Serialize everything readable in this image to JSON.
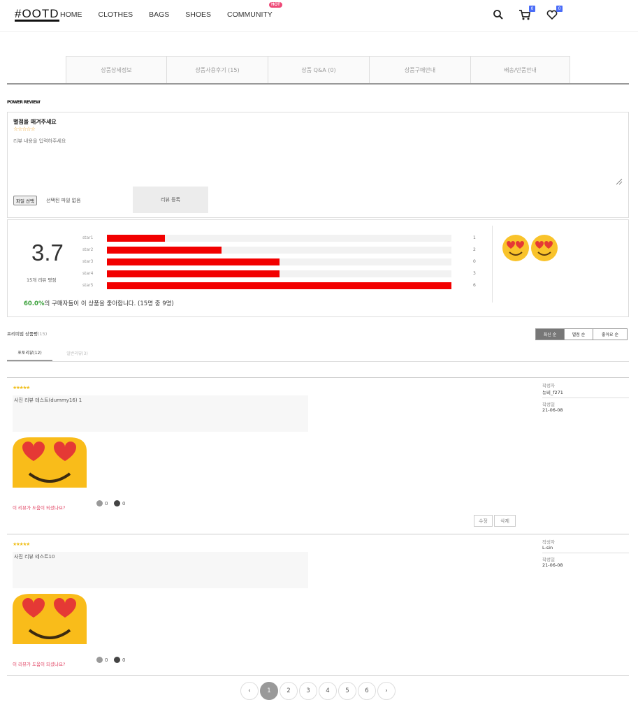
{
  "header": {
    "logo": "#OOTD",
    "nav": [
      {
        "label": "HOME"
      },
      {
        "label": "CLOTHES"
      },
      {
        "label": "BAGS"
      },
      {
        "label": "SHOES"
      },
      {
        "label": "COMMUNITY",
        "badge": "HOT"
      }
    ],
    "cart_count": "0",
    "wish_count": "0"
  },
  "tabs": [
    {
      "label": "상품상세정보"
    },
    {
      "label": "상품사용후기 (15)"
    },
    {
      "label": "상품 Q&A (0)"
    },
    {
      "label": "상품구매안내"
    },
    {
      "label": "배송/반품안내"
    }
  ],
  "power_review_title": "POWER REVIEW",
  "form": {
    "title": "별점을 매겨주세요",
    "stars": "☆☆☆☆☆",
    "placeholder": "리뷰 내용을 입력하주세요",
    "file_button": "파일 선택",
    "file_status": "선택된 파일 없음",
    "submit": "리뷰 등록"
  },
  "summary": {
    "average": "3.7",
    "count_text": "15개 리뷰 평점",
    "bars": [
      {
        "label": "star1",
        "count": "1",
        "fraction": 0.067
      },
      {
        "label": "star2",
        "count": "2",
        "fraction": 0.133
      },
      {
        "label": "star3",
        "count": "0",
        "fraction": 0.2
      },
      {
        "label": "star4",
        "count": "3",
        "fraction": 0.2
      },
      {
        "label": "star5",
        "count": "6",
        "fraction": 0.4
      }
    ],
    "recommend_pct": "60.0%",
    "recommend_text": "의 구매자들이 이 상품을 좋아합니다. (15명 중 9명)"
  },
  "list": {
    "title": "프리미엄 상품평",
    "count": "(15)",
    "sort": [
      "최신 순",
      "별점 순",
      "좋아요 순"
    ],
    "subtabs": [
      "포토리뷰(12)",
      "일반리뷰(3)"
    ]
  },
  "reviews": [
    {
      "stars": "★★★★★",
      "text": "사진 리뷰 테스트(dummy16) 1",
      "question": "이 리뷰가 도움이 되셨나요?",
      "likes": "0",
      "dislikes": "0",
      "author_label": "작성자",
      "author": "뉴비_f271",
      "date_label": "작성일",
      "date": "21-06-08",
      "edit": "수정",
      "delete": "삭제"
    },
    {
      "stars": "★★★★★",
      "text": "사진 리뷰 테스트10",
      "question": "이 리뷰가 도움이 되셨나요?",
      "likes": "0",
      "dislikes": "0",
      "author_label": "작성자",
      "author": "L-sin",
      "date_label": "작성일",
      "date": "21-06-08"
    }
  ],
  "pagination": {
    "prev": "‹",
    "pages": [
      "1",
      "2",
      "3",
      "4",
      "5",
      "6"
    ],
    "next": "›",
    "current": "1"
  }
}
